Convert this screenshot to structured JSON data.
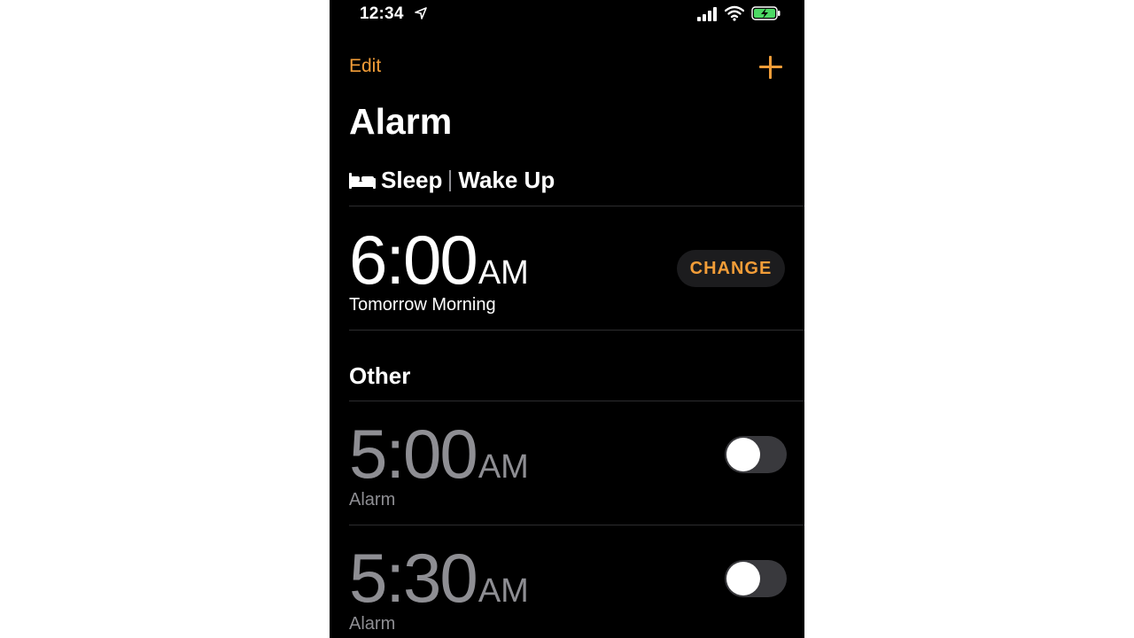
{
  "status_bar": {
    "time": "12:34",
    "icons": [
      "location-arrow-icon",
      "cellular-signal-icon",
      "wifi-icon",
      "battery-charging-icon"
    ],
    "battery_color": "#4cd964"
  },
  "nav": {
    "edit_label": "Edit",
    "add_icon": "plus-icon",
    "accent_color": "#f29d38"
  },
  "page_title": "Alarm",
  "sleep_section": {
    "icon": "bed-icon",
    "label_sleep": "Sleep",
    "label_wake": "Wake Up",
    "alarm": {
      "time": "6:00",
      "period": "AM",
      "subtitle": "Tomorrow Morning",
      "change_label": "CHANGE"
    }
  },
  "other_section": {
    "title": "Other",
    "alarms": [
      {
        "time": "5:00",
        "period": "AM",
        "label": "Alarm",
        "enabled": false
      },
      {
        "time": "5:30",
        "period": "AM",
        "label": "Alarm",
        "enabled": false
      }
    ]
  }
}
